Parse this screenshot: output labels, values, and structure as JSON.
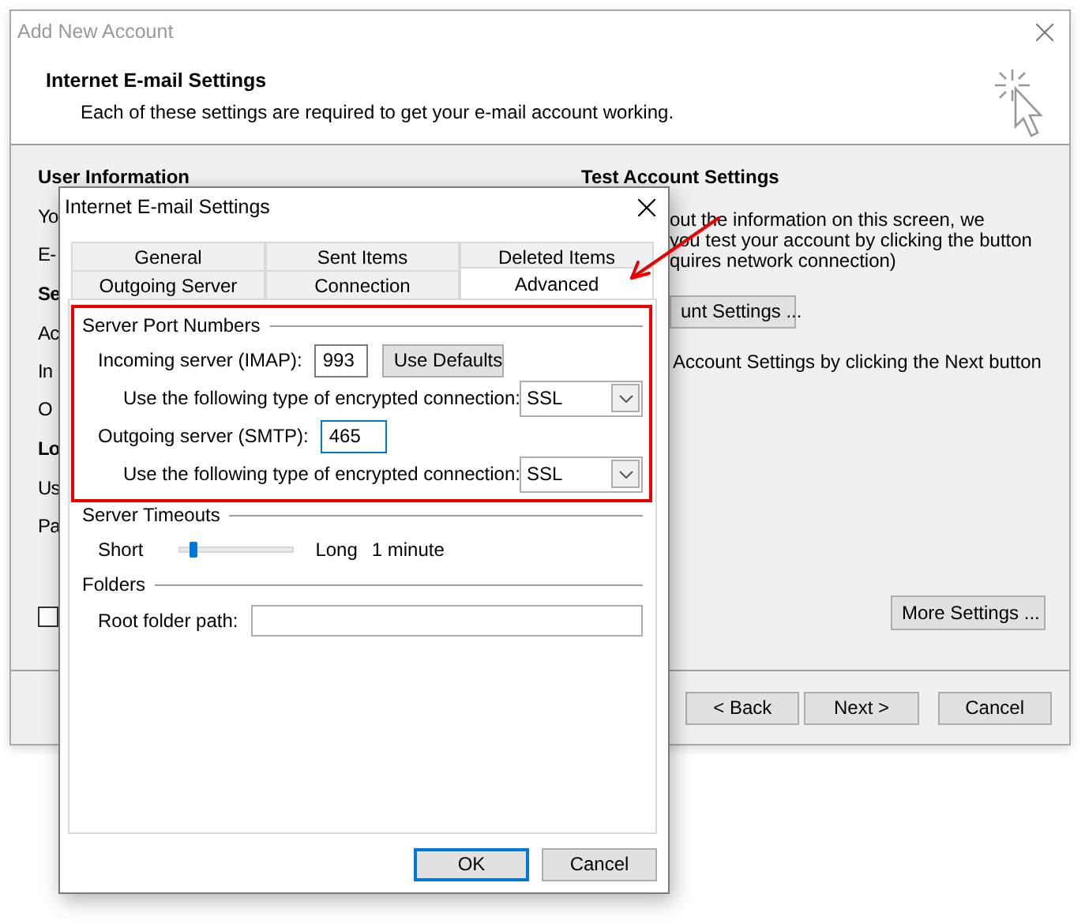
{
  "main_window": {
    "title": "Add New Account",
    "header": {
      "title": "Internet E-mail Settings",
      "subtitle": "Each of these settings are required to get your e-mail account working."
    },
    "left_labels": [
      {
        "text": "User Information",
        "kind": "heading"
      },
      {
        "text": "Yo",
        "kind": "label"
      },
      {
        "text": "E-",
        "kind": "label"
      },
      {
        "text": "Se",
        "kind": "heading"
      },
      {
        "text": "Ac",
        "kind": "label"
      },
      {
        "text": "In",
        "kind": "label"
      },
      {
        "text": "O",
        "kind": "label"
      },
      {
        "text": "Lo",
        "kind": "heading"
      },
      {
        "text": "Us",
        "kind": "label"
      },
      {
        "text": "Pa",
        "kind": "label"
      }
    ],
    "checkbox": {
      "checked": false
    },
    "test_panel": {
      "heading": "Test Account Settings",
      "lines": [
        "out the information on this screen, we",
        "you test your account by clicking the button",
        "quires network connection)"
      ],
      "test_button": "unt Settings ...",
      "note": "Account Settings by clicking the Next button"
    },
    "more_settings_button": "More Settings ...",
    "footer_buttons": [
      "< Back",
      "Next >",
      "Cancel"
    ]
  },
  "dialog": {
    "title": "Internet E-mail Settings",
    "tab_rows": [
      {
        "tabs": [
          {
            "label": "General",
            "selected": false
          },
          {
            "label": "Sent Items",
            "selected": false
          },
          {
            "label": "Deleted Items",
            "selected": false
          }
        ]
      },
      {
        "tabs": [
          {
            "label": "Outgoing Server",
            "selected": false
          },
          {
            "label": "Connection",
            "selected": false
          },
          {
            "label": "Advanced",
            "selected": true
          }
        ]
      }
    ],
    "server_port_numbers": {
      "legend": "Server Port Numbers",
      "incoming": {
        "label": "Incoming server (IMAP):",
        "value": "993",
        "focused": false
      },
      "use_defaults_button": "Use Defaults",
      "incoming_encryption": {
        "label": "Use the following type of encrypted connection:",
        "value": "SSL"
      },
      "outgoing": {
        "label": "Outgoing server (SMTP):",
        "value": "465",
        "focused": true
      },
      "outgoing_encryption": {
        "label": "Use the following type of encrypted connection:",
        "value": "SSL"
      }
    },
    "server_timeouts": {
      "legend": "Server Timeouts",
      "min_label": "Short",
      "max_label": "Long",
      "level": 0.1,
      "reading": "1 minute"
    },
    "folders": {
      "legend": "Folders",
      "root_folder_path": {
        "label": "Root folder path:"
      }
    },
    "buttons": [
      {
        "label": "OK",
        "default": true
      },
      {
        "label": "Cancel",
        "default": false
      }
    ]
  }
}
